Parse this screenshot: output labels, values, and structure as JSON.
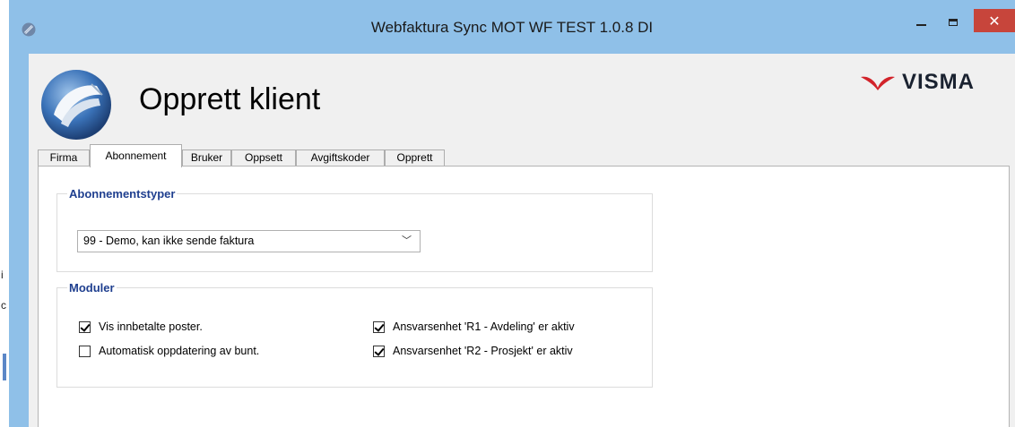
{
  "window": {
    "title": "Webfaktura Sync MOT WF TEST 1.0.8 DI",
    "controls": {
      "minimize_icon": "minimize-icon",
      "maximize_icon": "maximize-icon",
      "close_icon": "close-icon"
    }
  },
  "header": {
    "title": "Opprett klient",
    "brand": "VISMA"
  },
  "tabs": [
    {
      "label": "Firma",
      "active": false
    },
    {
      "label": "Abonnement",
      "active": true
    },
    {
      "label": "Bruker",
      "active": false
    },
    {
      "label": "Oppsett",
      "active": false
    },
    {
      "label": "Avgiftskoder",
      "active": false
    },
    {
      "label": "Opprett",
      "active": false
    }
  ],
  "subscription": {
    "group_title": "Abonnementstyper",
    "selected": "99 - Demo, kan ikke sende faktura"
  },
  "modules": {
    "group_title": "Moduler",
    "options": [
      {
        "label": "Vis innbetalte poster.",
        "checked": true
      },
      {
        "label": "Automatisk oppdatering av bunt.",
        "checked": false
      },
      {
        "label": "Ansvarsenhet 'R1 - Avdeling' er aktiv",
        "checked": true
      },
      {
        "label": "Ansvarsenhet 'R2 - Prosjekt' er aktiv",
        "checked": true
      }
    ]
  },
  "colors": {
    "window_frame": "#8fc0e8",
    "close_button": "#c7453b",
    "group_title": "#1f3f8f",
    "visma_red": "#d2232a"
  }
}
